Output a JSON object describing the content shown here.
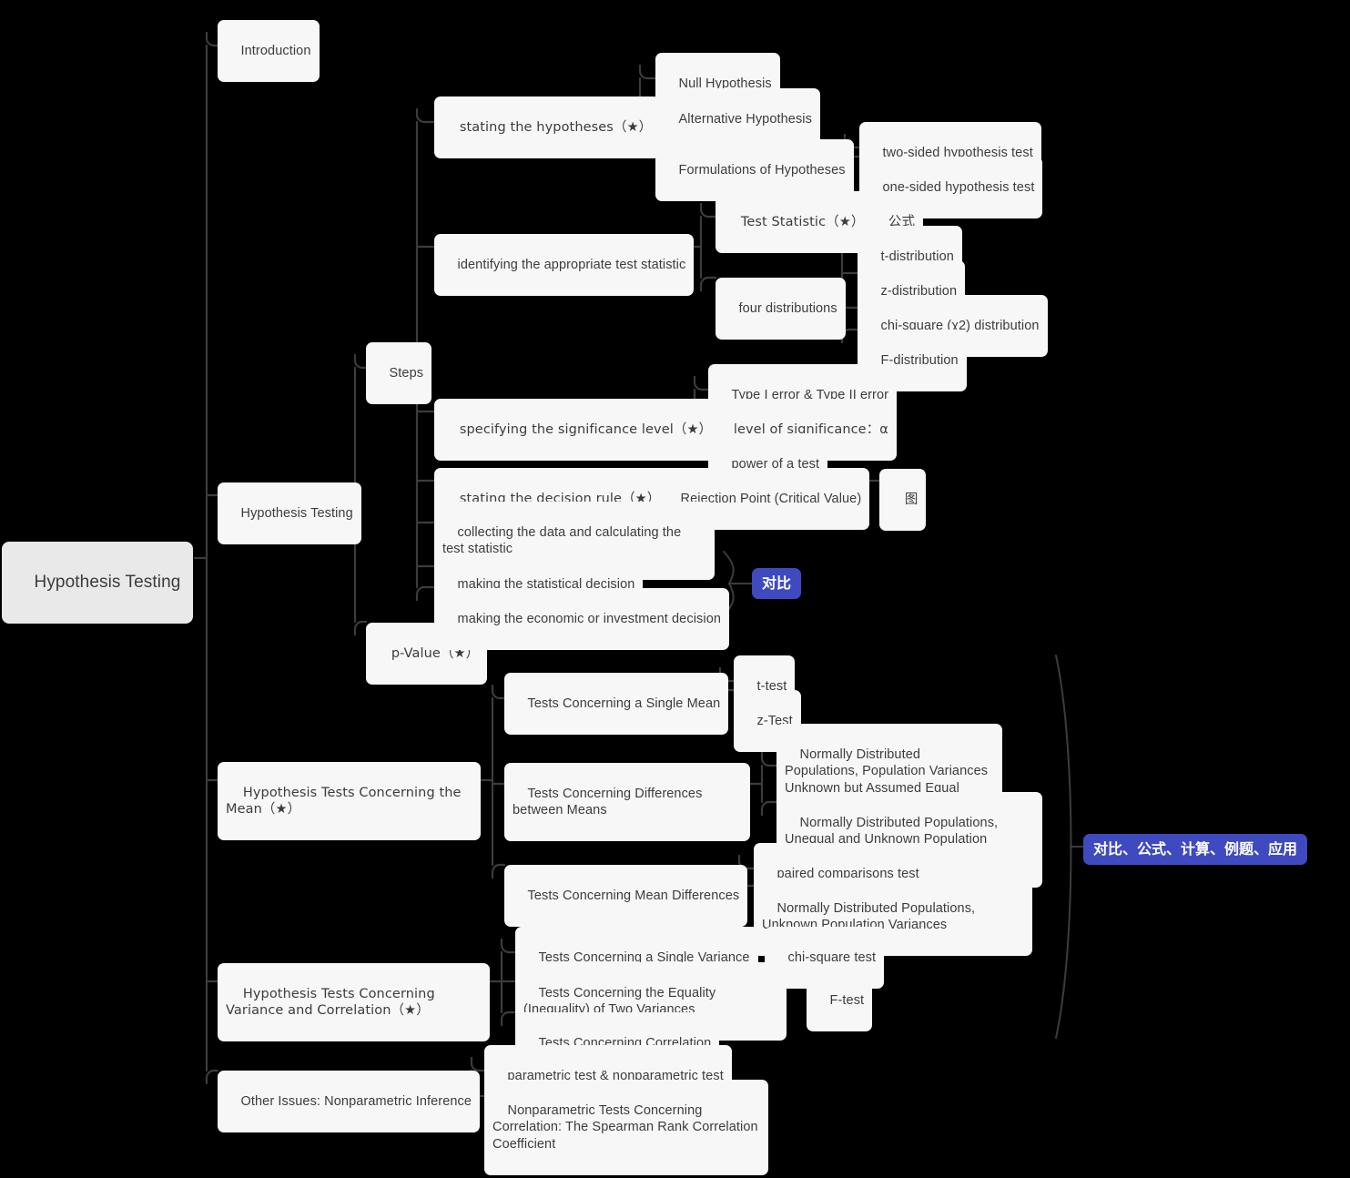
{
  "meta": {
    "title": "Hypothesis Testing",
    "background_color": "#000000",
    "node_color": "#f7f7f7",
    "root_node_color": "#e9e9e9",
    "text_color": "#3c3c3c",
    "badge_color": "#3f4ac0",
    "link_color": "#3c3c3c"
  },
  "root": {
    "label": "Hypothesis Testing"
  },
  "nodes": {
    "introduction": "Introduction",
    "hypothesis_testing": "Hypothesis Testing",
    "steps": "Steps",
    "p_value": "p-Value（★）",
    "stating_hypotheses": "stating the hypotheses（★）",
    "null_hypothesis": "Null Hypothesis",
    "alternative_hypothesis": "Alternative Hypothesis",
    "formulations": "Formulations of Hypotheses",
    "two_sided": "two-sided hypothesis test",
    "one_sided": "one-sided hypothesis test",
    "identifying_stat": "identifying the appropriate test statistic",
    "test_statistic": "Test Statistic（★）",
    "gongshi": "公式",
    "four_distributions": "four distributions",
    "t_distribution": "t-distribution",
    "z_distribution": "z-distribution",
    "chi_square_distribution": "chi-square (χ2) distribution",
    "f_distribution": "F-distribution",
    "specifying_significance": "specifying the significance level（★）",
    "type_errors": "Type I error & Type II error",
    "level_of_significance": "level of significance：α",
    "power_of_test": "power of a test",
    "stating_decision_rule": "stating the decision rule（★）",
    "rejection_point": "Rejection Point (Critical Value)",
    "tu": "图",
    "collecting_data": "collecting the data and calculating the test statistic",
    "statistical_decision": "making the statistical decision",
    "economic_decision": "making the economic or investment decision",
    "badge_duibi": "对比",
    "mean_tests": "Hypothesis Tests Concerning the Mean（★）",
    "single_mean": "Tests Concerning a Single Mean",
    "t_test": "t-test",
    "z_test": "z-Test",
    "diff_between_means": "Tests Concerning Differences between Means",
    "normal_equal_var": "Normally Distributed Populations, Population Variances Unknown but Assumed Equal",
    "normal_unequal_var": "Normally Distributed Populations, Unequal and Unknown Population Variances",
    "mean_differences": "Tests Concerning Mean Differences",
    "paired_comparisons": "paired comparisons test",
    "normal_unknown_var": "Normally Distributed Populations, Unknown Population Variances",
    "variance_correlation": "Hypothesis Tests Concerning Variance and Correlation（★）",
    "single_variance": "Tests Concerning a Single Variance",
    "chi_square_test": "chi-square test",
    "equality_two_variances": "Tests Concerning the Equality (Inequality) of Two Variances",
    "f_test": "F-test",
    "tests_correlation": "Tests Concerning Correlation",
    "other_issues": "Other Issues: Nonparametric Inference",
    "parametric_nonparametric": "parametric test & nonparametric test",
    "spearman": "Nonparametric Tests Concerning Correlation: The Spearman Rank Correlation Coefficient",
    "badge_duibi_gongshi": "对比、公式、计算、例题、应用"
  }
}
